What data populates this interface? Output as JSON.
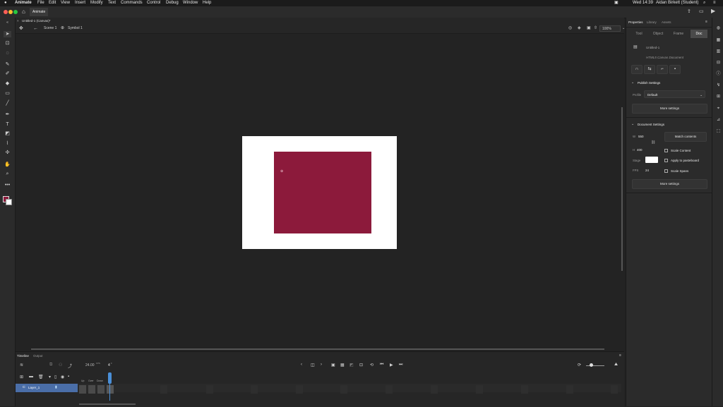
{
  "menubar": {
    "apple": "",
    "app_name": "Animate",
    "items": [
      "File",
      "Edit",
      "View",
      "Insert",
      "Modify",
      "Text",
      "Commands",
      "Control",
      "Debug",
      "Window",
      "Help"
    ],
    "clock": "Wed 14:39",
    "user": "Aidan Birkett (Student)"
  },
  "appbar": {
    "tab": "Animate"
  },
  "document": {
    "tab_title": "Untitled-1 (Canvas)*"
  },
  "editbar": {
    "scene": "Scene 1",
    "symbol": "Symbol 1",
    "zoom": "100%"
  },
  "properties": {
    "panel_tabs": [
      "Properties",
      "Library",
      "Assets"
    ],
    "sub_tabs": [
      "Tool",
      "Object",
      "Frame",
      "Doc"
    ],
    "active_sub_tab": "Doc",
    "doc_name": "Untitled-1",
    "doc_type": "HTML5 Canvas Document",
    "publish_settings_label": "Publish Settings",
    "profile_label": "Profile",
    "profile_value": "Default",
    "more_settings": "More settings",
    "document_settings_label": "Document Settings",
    "w_label": "W",
    "w_value": "550",
    "h_label": "H",
    "h_value": "400",
    "match_contents": "Match contents",
    "scale_content": "Scale Content",
    "stage_label": "Stage",
    "stage_color": "#ffffff",
    "apply_pasteboard": "Apply to pasteboard",
    "fps_label": "FPS",
    "fps_value": "24",
    "scale_spans": "Scale Spans",
    "more_settings2": "More settings"
  },
  "timeline": {
    "tabs": [
      "Timeline",
      "Output"
    ],
    "fps": "24.00",
    "fps_unit": "FPS",
    "frame": "4",
    "frame_unit": "F",
    "layer_name": "Layer_1",
    "frame_labels": [
      "Up",
      "Over",
      "Down"
    ],
    "frame_label_4": "Hit"
  },
  "colors": {
    "accent": "#4a6ea8",
    "stage_fill": "#8c1a3b",
    "stage_bg": "#ffffff"
  }
}
